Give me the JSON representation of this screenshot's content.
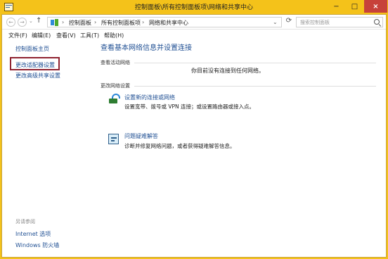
{
  "window": {
    "title": "控制面板\\所有控制面板项\\网络和共享中心",
    "minimize": "−",
    "maximize": "□",
    "close": "×"
  },
  "navigation": {
    "back": "←",
    "forward": "→",
    "recent": "⌄",
    "up": "↑",
    "breadcrumb": [
      "控制面板",
      "所有控制面板项",
      "网络和共享中心"
    ],
    "address_dropdown": "⌄",
    "refresh": "⟳",
    "search_placeholder": "搜索控制面板"
  },
  "menu": [
    "文件(F)",
    "编辑(E)",
    "查看(V)",
    "工具(T)",
    "帮助(H)"
  ],
  "sidebar": {
    "home": "控制面板主页",
    "change_adapter": "更改适配器设置",
    "advanced_sharing": "更改高级共享设置",
    "see_also": "另请参阅",
    "internet_options": "Internet 选项",
    "firewall": "Windows 防火墙"
  },
  "main": {
    "title": "查看基本网络信息并设置连接",
    "active_networks_label": "查看活动网络",
    "no_network": "你目前没有连接到任何网络。",
    "change_settings_label": "更改网络设置",
    "setup_link": "设置新的连接或网络",
    "setup_desc": "设置宽带、拨号或 VPN 连接；或设置路由器或接入点。",
    "troubleshoot_link": "问题疑难解答",
    "troubleshoot_desc": "诊断并修复网络问题，或者获得疑难解答信息。"
  },
  "colors": {
    "frame_accent": "#f4c21a",
    "close_button": "#c7413a",
    "link_blue": "#1f4f93",
    "highlight_box": "#8f2230"
  },
  "icons": [
    "app-icon",
    "back-icon",
    "forward-icon",
    "up-icon",
    "control-panel-icon",
    "refresh-icon",
    "search-icon",
    "network-setup-icon",
    "troubleshoot-icon"
  ]
}
